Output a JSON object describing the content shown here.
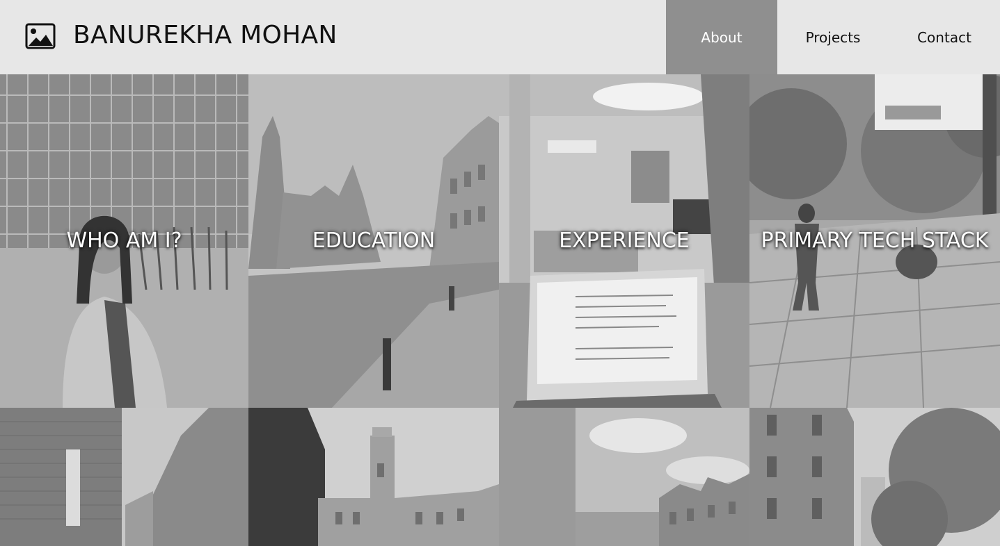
{
  "header": {
    "site_title": "BANUREKHA MOHAN",
    "nav": [
      {
        "label": "About",
        "active": true
      },
      {
        "label": "Projects",
        "active": false
      },
      {
        "label": "Contact",
        "active": false
      }
    ]
  },
  "tiles": [
    {
      "label": "WHO AM I?"
    },
    {
      "label": "EDUCATION"
    },
    {
      "label": "EXPERIENCE"
    },
    {
      "label": "PRIMARY TECH STACK"
    }
  ],
  "colors": {
    "header_bg": "#e7e7e7",
    "nav_active_bg": "#8f8f8f",
    "label_text": "#ffffff"
  }
}
